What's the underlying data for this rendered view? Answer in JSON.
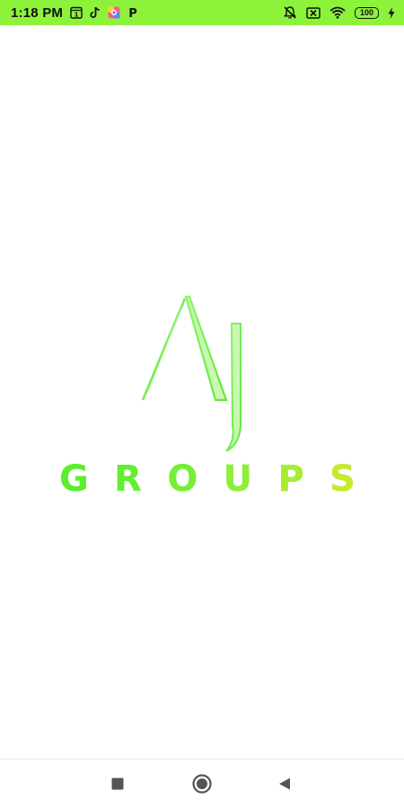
{
  "status_bar": {
    "time": "1:18 PM",
    "notification_icons": [
      "calendar-icon",
      "tiktok-icon",
      "photos-icon",
      "paytm-icon"
    ],
    "calendar_day": "1",
    "paytm_glyph": "P",
    "system_icons": [
      "alarm-off-icon",
      "sim-off-icon",
      "wifi-icon"
    ],
    "battery_level": "100",
    "charging": true,
    "background": "#8cf33a"
  },
  "logo": {
    "monogram": "AJ",
    "wordmark_letters": [
      "G",
      "R",
      "O",
      "U",
      "P",
      "S"
    ],
    "colors": [
      "#5bef2f",
      "#8def37",
      "#c5ea2e"
    ]
  },
  "nav_bar": {
    "buttons": [
      "recents",
      "home",
      "back"
    ]
  }
}
